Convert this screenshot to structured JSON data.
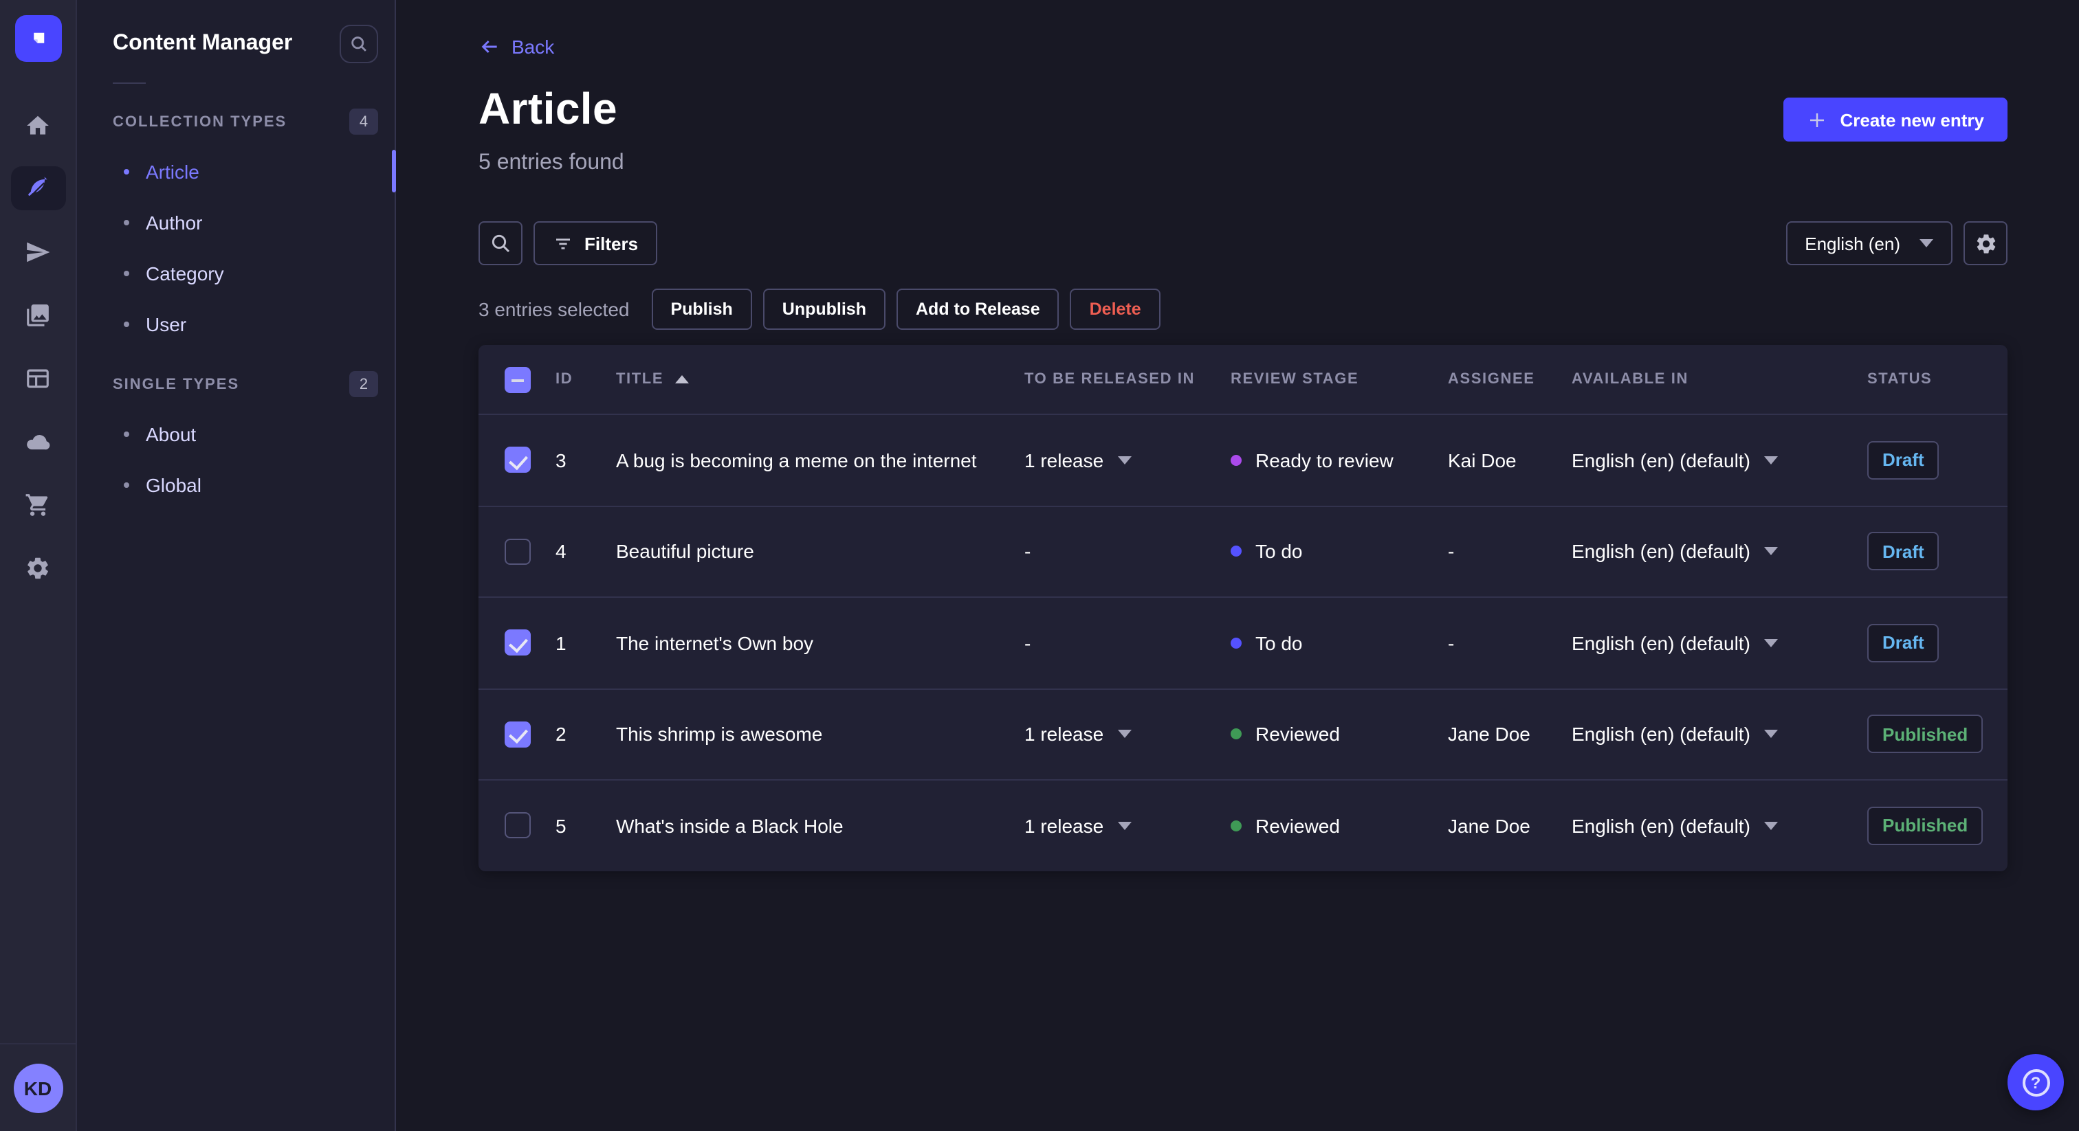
{
  "app": {
    "avatar_initials": "KD"
  },
  "rail": {
    "items": [
      {
        "name": "home"
      },
      {
        "name": "content-manager",
        "active": true
      },
      {
        "name": "releases"
      },
      {
        "name": "media-library"
      },
      {
        "name": "content-type-builder"
      },
      {
        "name": "deploy"
      },
      {
        "name": "marketplace"
      },
      {
        "name": "settings"
      }
    ]
  },
  "subnav": {
    "title": "Content Manager",
    "sections": [
      {
        "label": "COLLECTION TYPES",
        "badge": "4",
        "items": [
          {
            "label": "Article",
            "active": true
          },
          {
            "label": "Author"
          },
          {
            "label": "Category"
          },
          {
            "label": "User"
          }
        ]
      },
      {
        "label": "SINGLE TYPES",
        "badge": "2",
        "items": [
          {
            "label": "About"
          },
          {
            "label": "Global"
          }
        ]
      }
    ]
  },
  "header": {
    "back_label": "Back",
    "title": "Article",
    "subtitle": "5 entries found",
    "create_label": "Create new entry"
  },
  "toolbar": {
    "filters_label": "Filters",
    "locale_value": "English (en)"
  },
  "selection": {
    "text": "3 entries selected",
    "publish": "Publish",
    "unpublish": "Unpublish",
    "add_to_release": "Add to Release",
    "delete": "Delete"
  },
  "table": {
    "select_all_state": "indeterminate",
    "sorted_column": "TITLE",
    "columns": [
      "ID",
      "TITLE",
      "TO BE RELEASED IN",
      "REVIEW STAGE",
      "ASSIGNEE",
      "AVAILABLE IN",
      "STATUS"
    ],
    "rows": [
      {
        "checked": true,
        "id": "3",
        "title": "A bug is becoming a meme on the internet",
        "release": "1 release",
        "stage": "Ready to review",
        "stage_color": "#ab4aeb",
        "assignee": "Kai Doe",
        "locale": "English (en) (default)",
        "status": "Draft"
      },
      {
        "checked": false,
        "id": "4",
        "title": "Beautiful picture",
        "release": "-",
        "stage": "To do",
        "stage_color": "#5552ff",
        "assignee": "-",
        "locale": "English (en) (default)",
        "status": "Draft"
      },
      {
        "checked": true,
        "id": "1",
        "title": "The internet's Own boy",
        "release": "-",
        "stage": "To do",
        "stage_color": "#5552ff",
        "assignee": "-",
        "locale": "English (en) (default)",
        "status": "Draft"
      },
      {
        "checked": true,
        "id": "2",
        "title": "This shrimp is awesome",
        "release": "1 release",
        "stage": "Reviewed",
        "stage_color": "#3f9a56",
        "assignee": "Jane Doe",
        "locale": "English (en) (default)",
        "status": "Published"
      },
      {
        "checked": false,
        "id": "5",
        "title": "What's inside a Black Hole",
        "release": "1 release",
        "stage": "Reviewed",
        "stage_color": "#3f9a56",
        "assignee": "Jane Doe",
        "locale": "English (en) (default)",
        "status": "Published"
      }
    ]
  },
  "colors": {
    "primary": "#4945ff",
    "primary_light": "#7b79ff",
    "success": "#5cb176",
    "danger": "#ee5e52",
    "draft_blue": "#66b7f1"
  }
}
